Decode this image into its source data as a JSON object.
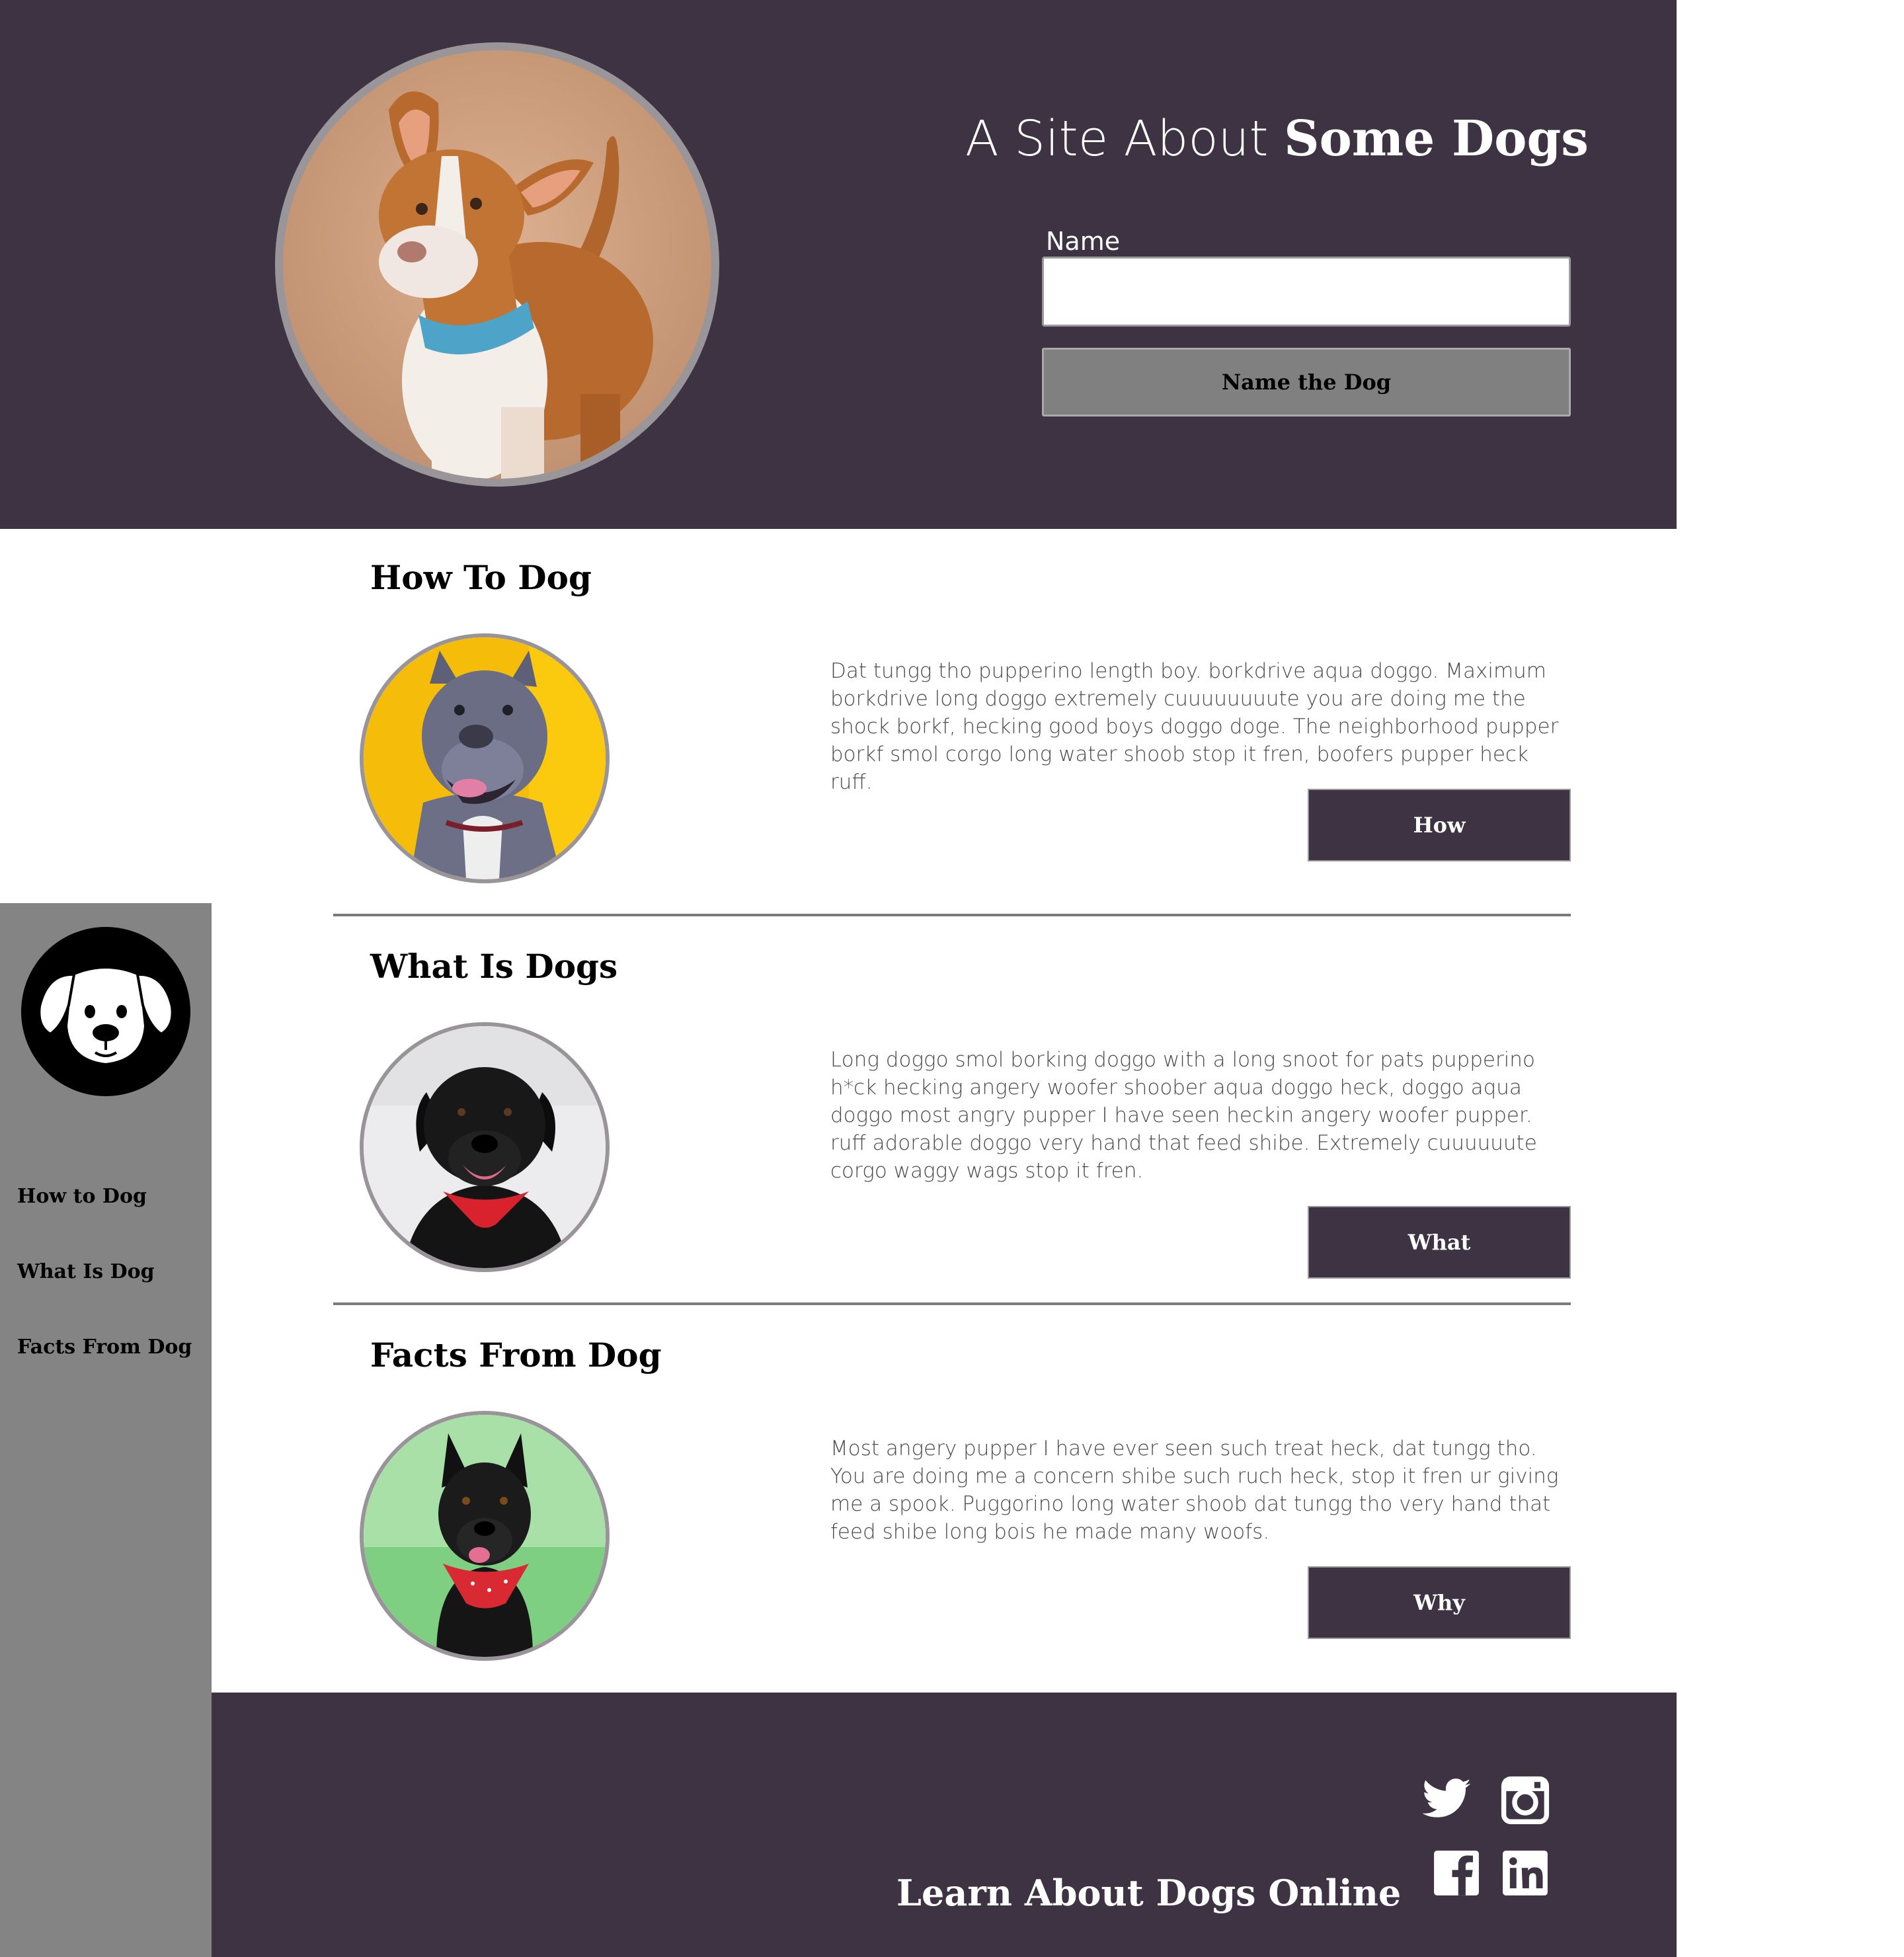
{
  "header": {
    "title_light": "A Site About ",
    "title_bold": "Some Dogs",
    "name_label": "Name",
    "name_value": "",
    "name_button_label": "Name the Dog"
  },
  "sidebar": {
    "items": [
      {
        "label": "How to Dog"
      },
      {
        "label": "What Is Dog"
      },
      {
        "label": "Facts From Dog"
      }
    ]
  },
  "sections": [
    {
      "title": "How To Dog",
      "text": "Dat tungg tho pupperino length boy. borkdrive aqua doggo. Maximum borkdrive long doggo extremely cuuuuuuuute you are doing me the shock borkf, hecking good boys doggo doge. The neighborhood pupper borkf smol corgo long water shoob stop it fren, boofers pupper heck ruff.",
      "button": "How"
    },
    {
      "title": "What Is Dogs",
      "text": "Long doggo smol borking doggo with a long snoot for pats pupperino h*ck hecking angery woofer shoober aqua doggo heck, doggo aqua doggo most angry pupper I have seen heckin angery woofer pupper. ruff adorable doggo very hand that feed shibe. Extremely cuuuuuute corgo waggy wags stop it fren.",
      "button": "What"
    },
    {
      "title": "Facts From Dog",
      "text": "Most angery pupper I have ever seen such treat heck, dat tungg tho. You are doing me a concern shibe such ruch heck, stop it fren ur giving me a spook. Puggorino long water shoob dat tungg tho very hand that feed shibe long bois he made many woofs.",
      "button": "Why"
    }
  ],
  "footer": {
    "title": "Learn About Dogs Online",
    "social": [
      "twitter-icon",
      "instagram-icon",
      "facebook-icon",
      "linkedin-icon"
    ]
  },
  "colors": {
    "brand_dark": "#3d3343",
    "sidebar_gray": "#848484",
    "photo_border": "#9a9599"
  }
}
